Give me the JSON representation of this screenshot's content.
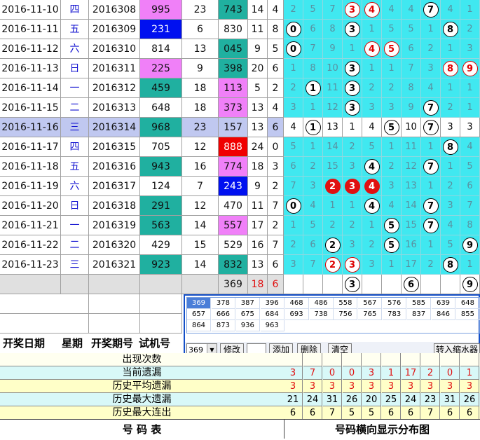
{
  "rows": [
    {
      "date": "2016-11-10",
      "week": "四",
      "issue": "2016308",
      "test": "995",
      "sum1": "23",
      "num": "743",
      "s2": "14",
      "k": "4",
      "hl": false,
      "cells": [
        "2",
        "5",
        "7",
        "3",
        "4",
        "4",
        "4",
        "7",
        "4",
        "1"
      ],
      "balls": [
        null,
        null,
        null,
        "r",
        "r",
        null,
        null,
        "w",
        null,
        null
      ]
    },
    {
      "date": "2016-11-11",
      "week": "五",
      "issue": "2016309",
      "test": "231",
      "sum1": "6",
      "num": "830",
      "s2": "11",
      "k": "8",
      "hl": false,
      "cells": [
        "0",
        "6",
        "8",
        "3",
        "1",
        "5",
        "5",
        "1",
        "8",
        "2"
      ],
      "balls": [
        "w",
        null,
        null,
        "w",
        null,
        null,
        null,
        null,
        "w",
        null
      ]
    },
    {
      "date": "2016-11-12",
      "week": "六",
      "issue": "2016310",
      "test": "814",
      "sum1": "13",
      "num": "045",
      "s2": "9",
      "k": "5",
      "hl": false,
      "cells": [
        "0",
        "7",
        "9",
        "1",
        "4",
        "5",
        "6",
        "2",
        "1",
        "3"
      ],
      "balls": [
        "w",
        null,
        null,
        null,
        "r",
        "r",
        null,
        null,
        null,
        null
      ]
    },
    {
      "date": "2016-11-13",
      "week": "日",
      "issue": "2016311",
      "test": "225",
      "sum1": "9",
      "num": "398",
      "s2": "20",
      "k": "6",
      "hl": false,
      "cells": [
        "1",
        "8",
        "10",
        "3",
        "1",
        "1",
        "7",
        "3",
        "8",
        "9"
      ],
      "balls": [
        null,
        null,
        null,
        "w",
        null,
        null,
        null,
        null,
        "r",
        "r"
      ]
    },
    {
      "date": "2016-11-14",
      "week": "一",
      "issue": "2016312",
      "test": "459",
      "sum1": "18",
      "num": "113",
      "s2": "5",
      "k": "2",
      "hl": false,
      "cells": [
        "2",
        "1",
        "11",
        "3",
        "2",
        "2",
        "8",
        "4",
        "1",
        "1"
      ],
      "balls": [
        null,
        "w",
        null,
        "w",
        null,
        null,
        null,
        null,
        null,
        null
      ]
    },
    {
      "date": "2016-11-15",
      "week": "二",
      "issue": "2016313",
      "test": "648",
      "sum1": "18",
      "num": "373",
      "s2": "13",
      "k": "4",
      "hl": false,
      "cells": [
        "3",
        "1",
        "12",
        "3",
        "3",
        "3",
        "9",
        "7",
        "2",
        "1"
      ],
      "balls": [
        null,
        null,
        null,
        "w",
        null,
        null,
        null,
        "w",
        null,
        null
      ]
    },
    {
      "date": "2016-11-16",
      "week": "三",
      "issue": "2016314",
      "test": "968",
      "sum1": "23",
      "num": "157",
      "s2": "13",
      "k": "6",
      "hl": true,
      "cells": [
        "4",
        "1",
        "13",
        "1",
        "4",
        "5",
        "10",
        "7",
        "3",
        "3"
      ],
      "balls": [
        null,
        "w",
        null,
        null,
        null,
        "w",
        null,
        "w",
        null,
        null
      ]
    },
    {
      "date": "2016-11-17",
      "week": "四",
      "issue": "2016315",
      "test": "705",
      "sum1": "12",
      "num": "888",
      "s2": "24",
      "k": "0",
      "hl": false,
      "cells": [
        "5",
        "1",
        "14",
        "2",
        "5",
        "1",
        "11",
        "1",
        "8",
        "4"
      ],
      "balls": [
        null,
        null,
        null,
        null,
        null,
        null,
        null,
        null,
        "w",
        null
      ]
    },
    {
      "date": "2016-11-18",
      "week": "五",
      "issue": "2016316",
      "test": "943",
      "sum1": "16",
      "num": "774",
      "s2": "18",
      "k": "3",
      "hl": false,
      "cells": [
        "6",
        "2",
        "15",
        "3",
        "4",
        "2",
        "12",
        "7",
        "1",
        "5"
      ],
      "balls": [
        null,
        null,
        null,
        null,
        "w",
        null,
        null,
        "w",
        null,
        null
      ]
    },
    {
      "date": "2016-11-19",
      "week": "六",
      "issue": "2016317",
      "test": "124",
      "sum1": "7",
      "num": "243",
      "s2": "9",
      "k": "2",
      "hl": false,
      "cells": [
        "7",
        "3",
        "2",
        "3",
        "4",
        "3",
        "13",
        "1",
        "2",
        "6"
      ],
      "balls": [
        null,
        null,
        "rf",
        "rf",
        "rf",
        null,
        null,
        null,
        null,
        null
      ]
    },
    {
      "date": "2016-11-20",
      "week": "日",
      "issue": "2016318",
      "test": "291",
      "sum1": "12",
      "num": "470",
      "s2": "11",
      "k": "7",
      "hl": false,
      "cells": [
        "0",
        "4",
        "1",
        "1",
        "4",
        "4",
        "14",
        "7",
        "3",
        "7"
      ],
      "balls": [
        "w",
        null,
        null,
        null,
        "w",
        null,
        null,
        "w",
        null,
        null
      ]
    },
    {
      "date": "2016-11-21",
      "week": "一",
      "issue": "2016319",
      "test": "563",
      "sum1": "14",
      "num": "557",
      "s2": "17",
      "k": "2",
      "hl": false,
      "cells": [
        "1",
        "5",
        "2",
        "2",
        "1",
        "5",
        "15",
        "7",
        "4",
        "8"
      ],
      "balls": [
        null,
        null,
        null,
        null,
        null,
        "w",
        null,
        "w",
        null,
        null
      ]
    },
    {
      "date": "2016-11-22",
      "week": "二",
      "issue": "2016320",
      "test": "429",
      "sum1": "15",
      "num": "529",
      "s2": "16",
      "k": "7",
      "hl": false,
      "cells": [
        "2",
        "6",
        "2",
        "3",
        "2",
        "5",
        "16",
        "1",
        "5",
        "9"
      ],
      "balls": [
        null,
        null,
        "w",
        null,
        null,
        "w",
        null,
        null,
        null,
        "w"
      ]
    },
    {
      "date": "2016-11-23",
      "week": "三",
      "issue": "2016321",
      "test": "923",
      "sum1": "14",
      "num": "832",
      "s2": "13",
      "k": "6",
      "hl": false,
      "cells": [
        "3",
        "7",
        "2",
        "3",
        "3",
        "1",
        "17",
        "2",
        "8",
        "1"
      ],
      "balls": [
        null,
        null,
        "r",
        "r",
        null,
        null,
        null,
        null,
        "w",
        null
      ]
    }
  ],
  "pending": {
    "num": "369",
    "s2": "18",
    "k": "6",
    "balls": [
      null,
      null,
      null,
      "3",
      null,
      null,
      "6",
      null,
      null,
      "9"
    ]
  },
  "popup": {
    "numbers": [
      "369",
      "378",
      "387",
      "396",
      "468",
      "486",
      "558",
      "567",
      "576",
      "585",
      "639",
      "648",
      "657",
      "666",
      "675",
      "684",
      "693",
      "738",
      "756",
      "765",
      "783",
      "837",
      "846",
      "855",
      "864",
      "873",
      "936",
      "963"
    ],
    "select_value": "369",
    "buttons": {
      "modify": "修改",
      "add": "添加",
      "delete": "删除",
      "clear": "清空",
      "shrink": "转入缩水器"
    }
  },
  "headers": {
    "date": "开奖日期",
    "week": "星期",
    "issue": "开奖期号",
    "test": "试机号"
  },
  "stats": [
    {
      "label": "出现次数",
      "values": [
        "",
        "",
        "",
        "",
        "",
        "",
        "",
        "",
        "",
        ""
      ]
    },
    {
      "label": "当前遗漏",
      "values": [
        "3",
        "7",
        "0",
        "0",
        "3",
        "1",
        "17",
        "2",
        "0",
        "1"
      ]
    },
    {
      "label": "历史平均遗漏",
      "values": [
        "3",
        "3",
        "3",
        "3",
        "3",
        "3",
        "3",
        "3",
        "3",
        "3"
      ]
    },
    {
      "label": "历史最大遗漏",
      "values": [
        "21",
        "24",
        "31",
        "26",
        "20",
        "25",
        "24",
        "23",
        "31",
        "26"
      ]
    },
    {
      "label": "历史最大连出",
      "values": [
        "6",
        "6",
        "7",
        "5",
        "5",
        "6",
        "6",
        "7",
        "6",
        "6"
      ]
    }
  ],
  "footer": {
    "left": "号  码  表",
    "right": "号码横向显示分布图"
  },
  "colors": {
    "cyan": "#40e8f0",
    "magenta": "#f080f8",
    "teal": "#20b0a0",
    "blue": "#0010f0",
    "red": "#f00000",
    "highlight": "#c0c8f0"
  }
}
